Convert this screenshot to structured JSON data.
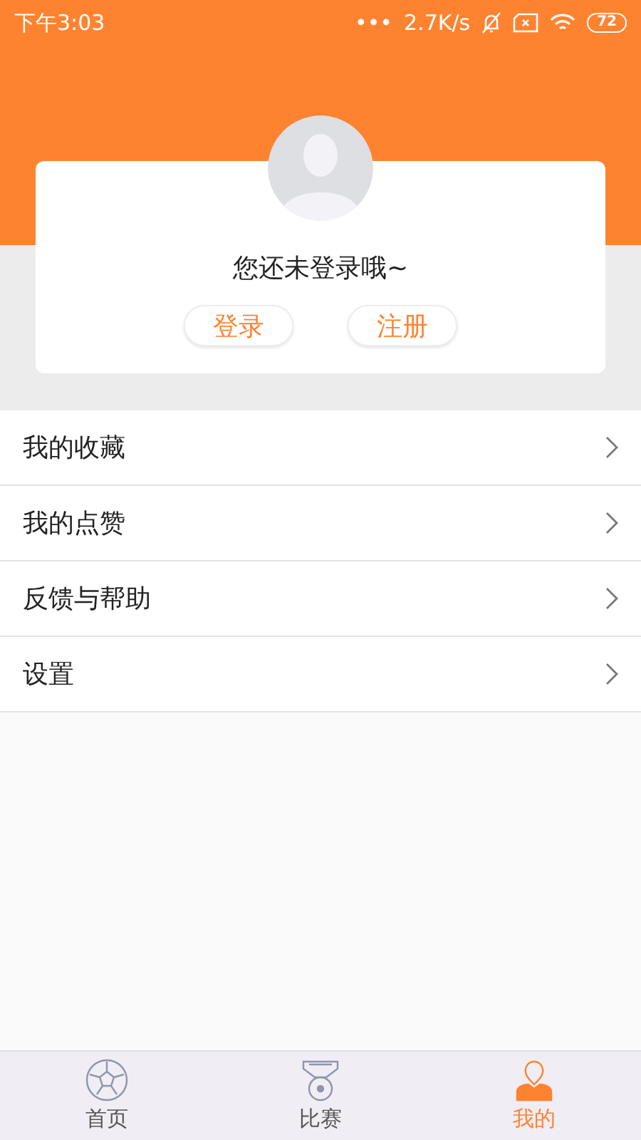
{
  "status_bar": {
    "time": "下午3:03",
    "dots": "•••",
    "speed": "2.7K/s",
    "battery": "72"
  },
  "profile_card": {
    "message": "您还未登录哦~",
    "buttons": [
      "登录",
      "注册"
    ]
  },
  "menu": [
    {
      "label": "我的收藏"
    },
    {
      "label": "我的点赞"
    },
    {
      "label": "反馈与帮助"
    },
    {
      "label": "设置"
    }
  ],
  "tab_bar": [
    {
      "label": "首页",
      "kind": "ball",
      "selected": false
    },
    {
      "label": "比赛",
      "kind": "medal",
      "selected": false
    },
    {
      "label": "我的",
      "kind": "person",
      "selected": true
    }
  ]
}
